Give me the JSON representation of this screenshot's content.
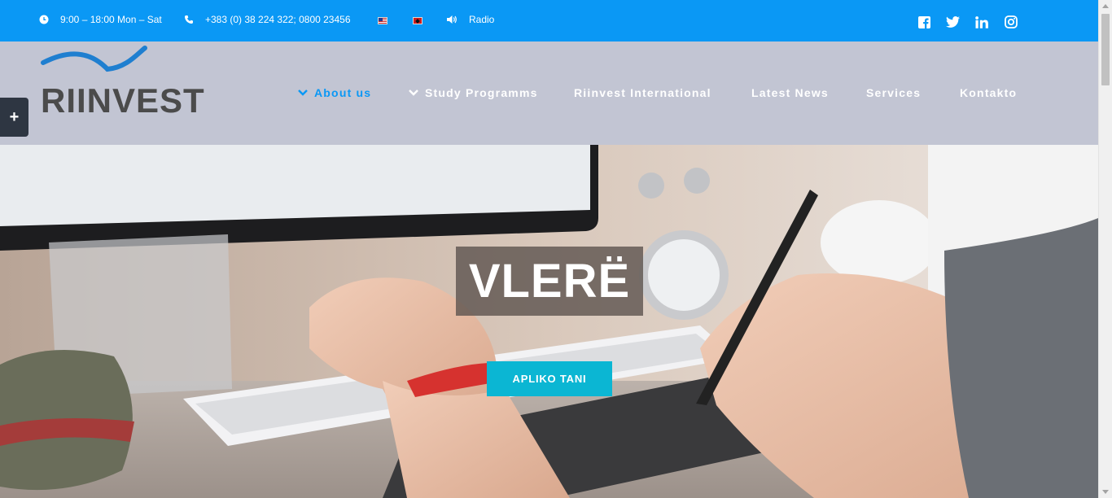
{
  "topbar": {
    "hours": "9:00 – 18:00 Mon – Sat",
    "phone": "+383 (0) 38 224 322; 0800 23456",
    "radio": "Radio",
    "languages": [
      "english-flag",
      "albanian-flag"
    ],
    "social": [
      "facebook-icon",
      "twitter-icon",
      "linkedin-icon",
      "instagram-icon"
    ]
  },
  "header": {
    "logo_text": "RIINVEST",
    "nav": [
      {
        "label": "About us",
        "has_dropdown": true,
        "active": true
      },
      {
        "label": "Study Programms",
        "has_dropdown": true,
        "active": false
      },
      {
        "label": "Riinvest International",
        "has_dropdown": false,
        "active": false
      },
      {
        "label": "Latest News",
        "has_dropdown": false,
        "active": false
      },
      {
        "label": "Services",
        "has_dropdown": false,
        "active": false
      },
      {
        "label": "Kontakto",
        "has_dropdown": false,
        "active": false
      }
    ]
  },
  "side_toggle": {
    "label": "+"
  },
  "hero": {
    "title": "VLERË",
    "cta": "APLIKO TANI"
  },
  "colors": {
    "topbar": "#0a98f5",
    "header": "#c2c5d3",
    "accent": "#0a98f5",
    "cta": "#0bb6d3",
    "logo_text": "#4b4b4b"
  }
}
